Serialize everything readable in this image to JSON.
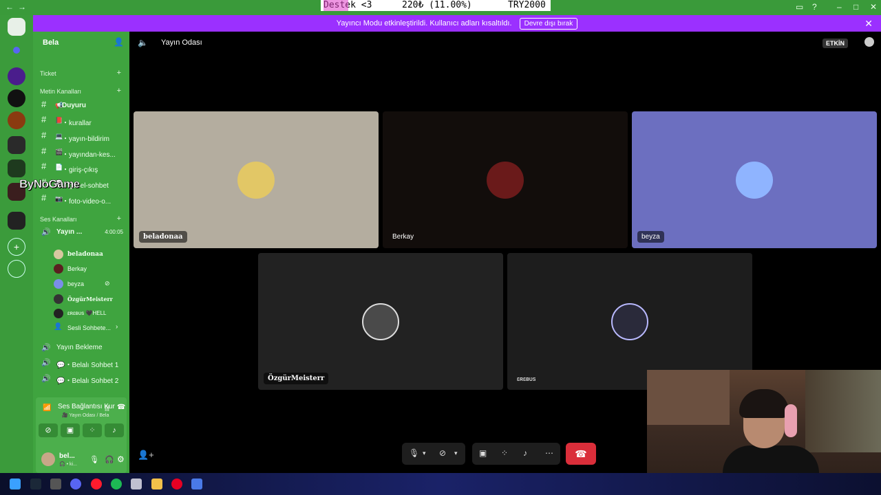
{
  "ticker": {
    "left": "Destek <3",
    "middle": "220₺ (11.00%)",
    "right": "TRY2000"
  },
  "banner": {
    "text": "Yayıncı Modu etkinleştirildi. Kullanıcı adları kısaltıldı.",
    "button": "Devre dışı bırak"
  },
  "server": {
    "name": "Bela"
  },
  "categories": {
    "ticket": "Ticket",
    "text": "Metin Kanalları",
    "voice": "Ses Kanalları"
  },
  "text_channels": [
    {
      "emoji": "📢",
      "label": "Duyuru"
    },
    {
      "emoji": "📕",
      "label": "・kurallar"
    },
    {
      "emoji": "💻",
      "label": "・yayın-bildirim"
    },
    {
      "emoji": "🎬",
      "label": "・yayından-kes..."
    },
    {
      "emoji": "📄",
      "label": "・giriş-çıkış"
    },
    {
      "emoji": "💬",
      "label": "・genel-sohbet"
    },
    {
      "emoji": "📷",
      "label": "・foto-video-o..."
    }
  ],
  "active_voice": {
    "label": "Yayın ...",
    "time": "4:00:05"
  },
  "members": [
    {
      "name": "beladonaa",
      "color": "#d8c8a0"
    },
    {
      "name": "Berkay",
      "color": "#5a2020"
    },
    {
      "name": "beyza",
      "color": "#7a8ee8"
    },
    {
      "name": "ÖzgürMeisterr",
      "color": "#333333"
    },
    {
      "name": "ɛʀɛʙᴜs  🖤HELL",
      "color": "#222222"
    },
    {
      "name": "Sesli Sohbete...",
      "color": "#3fa43f"
    }
  ],
  "voice_channels": [
    {
      "label": "Yayın Bekleme"
    },
    {
      "label": "💬・Belalı Sohbet 1"
    },
    {
      "label": "💬・Belalı Sohbet 2"
    }
  ],
  "voice_panel": {
    "title": "Ses Bağlantısı Kur",
    "subtitle": "🎥 Yayın Odası / Bela"
  },
  "user": {
    "name": "bel...",
    "status": "🎧 • ki..."
  },
  "watermark": "ByNoGame",
  "main": {
    "title": "Yayın Odası",
    "badge": "ETKİN"
  },
  "tiles": [
    {
      "name": "beladonaa",
      "bg": "#b4ad9f",
      "avatar": "#e2c766"
    },
    {
      "name": "Berkay",
      "bg": "#120d0b",
      "avatar": "#6a1a1a"
    },
    {
      "name": "beyza",
      "bg": "#6c6fc0",
      "avatar": "#8fb4ff"
    },
    {
      "name": "ÖzgürMeisterr",
      "bg": "#222222",
      "avatar": "#4a4a4a"
    },
    {
      "name": "ɛʀɛʙᴜs",
      "bg": "#1d1d1d",
      "avatar": "#2a2a3a"
    }
  ],
  "colors": {
    "accent": "#9b30ff",
    "sidebar": "#3fa43f",
    "rail": "#3b9b3b",
    "hangup": "#da2e3a"
  }
}
